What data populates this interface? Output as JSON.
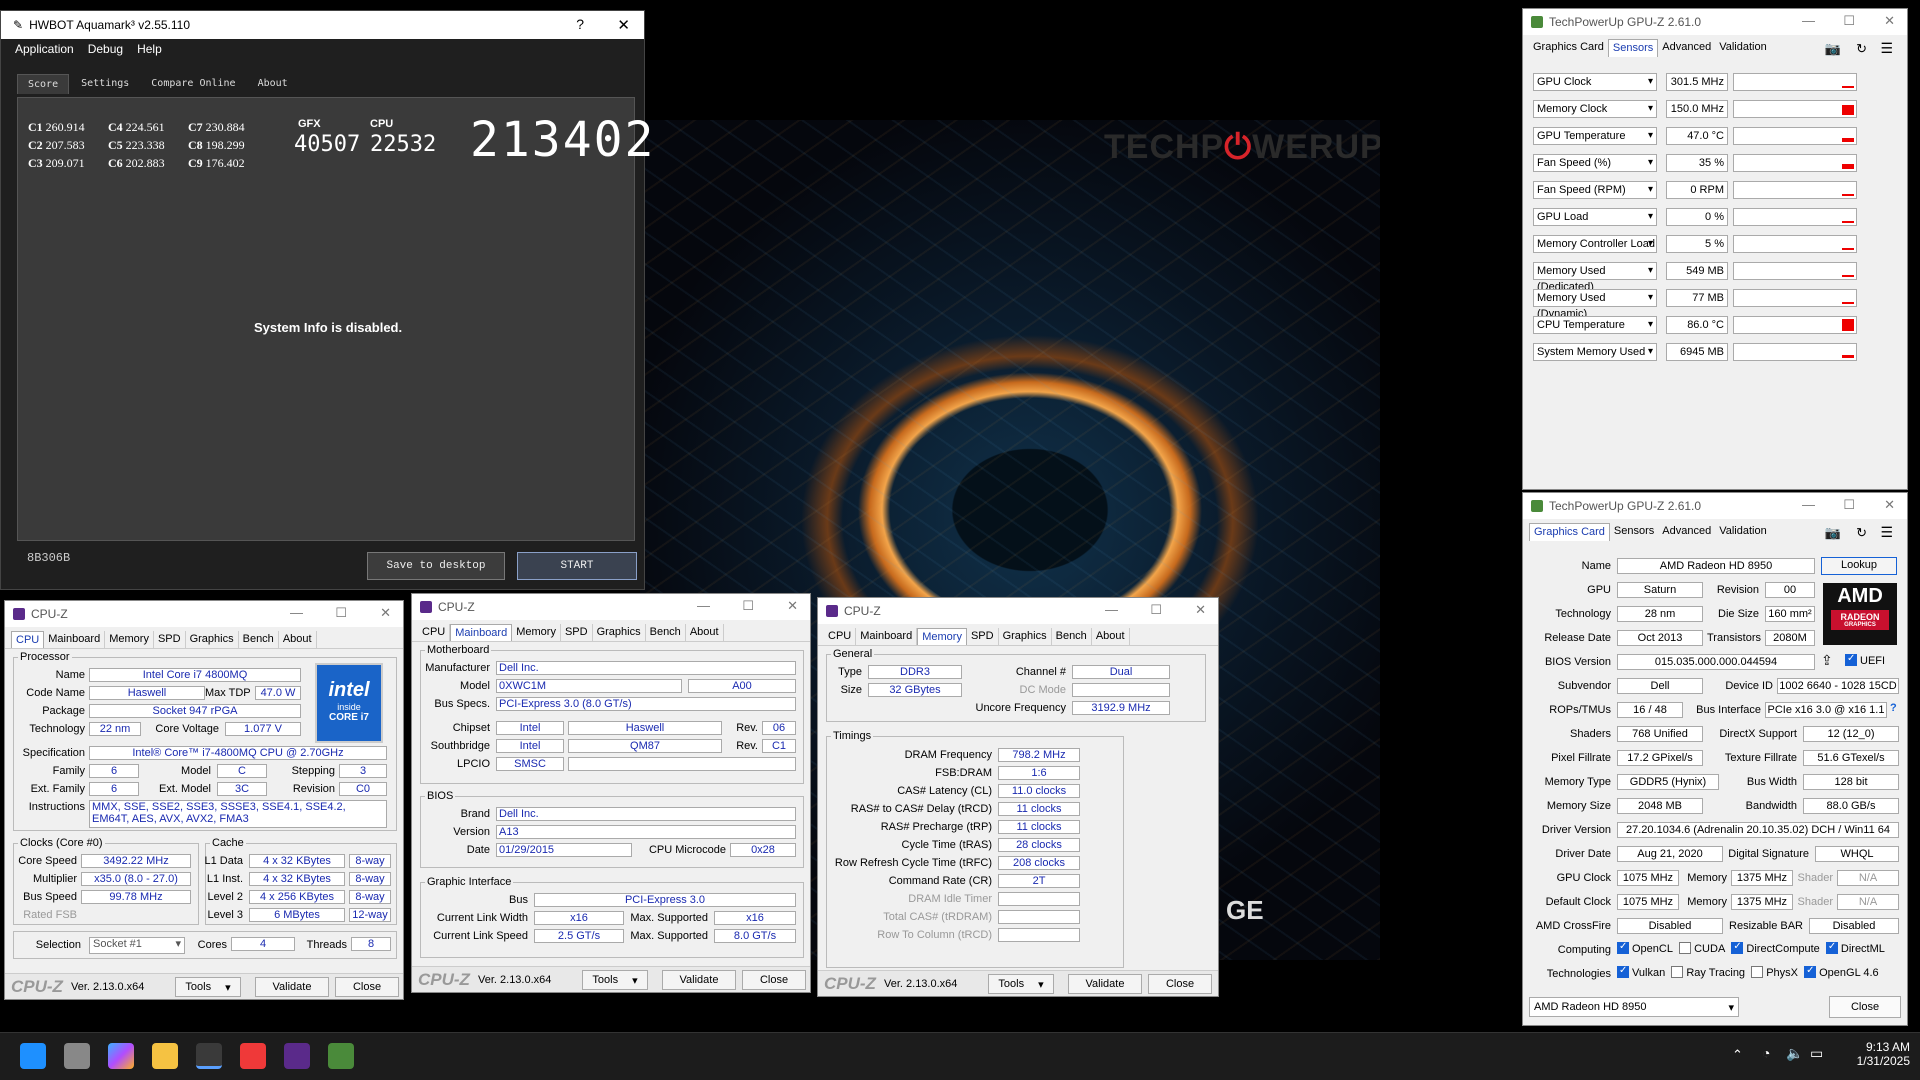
{
  "wallpaper": {
    "logo_tech": "TECHP",
    "logo_rest": "WERUP",
    "tail_text": "GE"
  },
  "aquamark": {
    "title": "HWBOT Aquamark³ v2.55.110",
    "help": "?",
    "close": "✕",
    "menu": [
      "Application",
      "Debug",
      "Help"
    ],
    "tabs": [
      "Score",
      "Settings",
      "Compare Online",
      "About"
    ],
    "scores": [
      [
        "C1",
        "260.914"
      ],
      [
        "C2",
        "207.583"
      ],
      [
        "C3",
        "209.071"
      ],
      [
        "C4",
        "224.561"
      ],
      [
        "C5",
        "223.338"
      ],
      [
        "C6",
        "202.883"
      ],
      [
        "C7",
        "230.884"
      ],
      [
        "C8",
        "198.299"
      ],
      [
        "C9",
        "176.402"
      ]
    ],
    "gfx_label": "GFX",
    "gfx_value": "40507",
    "cpu_label": "CPU",
    "cpu_value": "22532",
    "total": "213402",
    "sysinfo": "System Info is disabled.",
    "code": "8B306B",
    "save": "Save to desktop",
    "start": "START"
  },
  "cpuz1": {
    "title": "CPU-Z",
    "tabs": [
      "CPU",
      "Mainboard",
      "Memory",
      "SPD",
      "Graphics",
      "Bench",
      "About"
    ],
    "proc_legend": "Processor",
    "name_l": "Name",
    "name": "Intel Core i7 4800MQ",
    "code_l": "Code Name",
    "code": "Haswell",
    "tdp_l": "Max TDP",
    "tdp": "47.0 W",
    "pkg_l": "Package",
    "pkg": "Socket 947 rPGA",
    "tech_l": "Technology",
    "tech": "22 nm",
    "cv_l": "Core Voltage",
    "cv": "1.077 V",
    "spec_l": "Specification",
    "spec": "Intel® Core™ i7-4800MQ CPU @ 2.70GHz",
    "fam_l": "Family",
    "fam": "6",
    "model_l": "Model",
    "model": "C",
    "step_l": "Stepping",
    "step": "3",
    "efam_l": "Ext. Family",
    "efam": "6",
    "emodel_l": "Ext. Model",
    "emodel": "3C",
    "rev_l": "Revision",
    "rev": "C0",
    "inst_l": "Instructions",
    "inst": "MMX, SSE, SSE2, SSE3, SSSE3, SSE4.1, SSE4.2, EM64T, AES, AVX, AVX2, FMA3",
    "clk_legend": "Clocks (Core #0)",
    "cs_l": "Core Speed",
    "cs": "3492.22 MHz",
    "mul_l": "Multiplier",
    "mul": "x35.0 (8.0 - 27.0)",
    "bus_l": "Bus Speed",
    "bus": "99.78 MHz",
    "fsb_l": "Rated FSB",
    "cache_legend": "Cache",
    "l1d_l": "L1 Data",
    "l1d": "4 x 32 KBytes",
    "l1d_w": "8-way",
    "l1i_l": "L1 Inst.",
    "l1i": "4 x 32 KBytes",
    "l1i_w": "8-way",
    "l2_l": "Level 2",
    "l2": "4 x 256 KBytes",
    "l2_w": "8-way",
    "l3_l": "Level 3",
    "l3": "6 MBytes",
    "l3_w": "12-way",
    "sel_l": "Selection",
    "sel": "Socket #1",
    "cores_l": "Cores",
    "cores": "4",
    "thr_l": "Threads",
    "thr": "8",
    "intel_brand": "intel",
    "intel_inside": "inside",
    "intel_core": "CORE i7",
    "logo": "CPU-Z",
    "ver": "Ver. 2.13.0.x64",
    "tools": "Tools",
    "validate": "Validate",
    "close": "Close"
  },
  "cpuz2": {
    "title": "CPU-Z",
    "tabs": [
      "CPU",
      "Mainboard",
      "Memory",
      "SPD",
      "Graphics",
      "Bench",
      "About"
    ],
    "mb_legend": "Motherboard",
    "manu_l": "Manufacturer",
    "manu": "Dell Inc.",
    "model_l": "Model",
    "model": "0XWC1M",
    "model_rev": "A00",
    "bus_l": "Bus Specs.",
    "bus": "PCI-Express 3.0 (8.0 GT/s)",
    "chip_l": "Chipset",
    "chip": "Intel",
    "chip2": "Haswell",
    "chip_rl": "Rev.",
    "chip_r": "06",
    "sb_l": "Southbridge",
    "sb": "Intel",
    "sb2": "QM87",
    "sb_rl": "Rev.",
    "sb_r": "C1",
    "lpc_l": "LPCIO",
    "lpc": "SMSC",
    "bios_legend": "BIOS",
    "brand_l": "Brand",
    "brand": "Dell Inc.",
    "ver_l": "Version",
    "ver": "A13",
    "date_l": "Date",
    "date": "01/29/2015",
    "mc_l": "CPU Microcode",
    "mc": "0x28",
    "gi_legend": "Graphic Interface",
    "gbus_l": "Bus",
    "gbus": "PCI-Express 3.0",
    "clw_l": "Current Link Width",
    "clw": "x16",
    "msw_l": "Max. Supported",
    "msw": "x16",
    "cls_l": "Current Link Speed",
    "cls": "2.5 GT/s",
    "mss_l": "Max. Supported",
    "mss": "8.0 GT/s",
    "logo": "CPU-Z",
    "version": "Ver. 2.13.0.x64",
    "tools": "Tools",
    "validate": "Validate",
    "close": "Close"
  },
  "cpuz3": {
    "title": "CPU-Z",
    "tabs": [
      "CPU",
      "Mainboard",
      "Memory",
      "SPD",
      "Graphics",
      "Bench",
      "About"
    ],
    "gen_legend": "General",
    "type_l": "Type",
    "type": "DDR3",
    "ch_l": "Channel #",
    "ch": "Dual",
    "size_l": "Size",
    "size": "32 GBytes",
    "dc_l": "DC Mode",
    "uf_l": "Uncore Frequency",
    "uf": "3192.9 MHz",
    "tim_legend": "Timings",
    "rows": [
      [
        "DRAM Frequency",
        "798.2 MHz"
      ],
      [
        "FSB:DRAM",
        "1:6"
      ],
      [
        "CAS# Latency (CL)",
        "11.0 clocks"
      ],
      [
        "RAS# to CAS# Delay (tRCD)",
        "11 clocks"
      ],
      [
        "RAS# Precharge (tRP)",
        "11 clocks"
      ],
      [
        "Cycle Time (tRAS)",
        "28 clocks"
      ],
      [
        "Row Refresh Cycle Time (tRFC)",
        "208 clocks"
      ],
      [
        "Command Rate (CR)",
        "2T"
      ],
      [
        "DRAM Idle Timer",
        ""
      ],
      [
        "Total CAS# (tRDRAM)",
        ""
      ],
      [
        "Row To Column (tRCD)",
        ""
      ]
    ],
    "logo": "CPU-Z",
    "version": "Ver. 2.13.0.x64",
    "tools": "Tools",
    "validate": "Validate",
    "close": "Close"
  },
  "gpuz1": {
    "title": "TechPowerUp GPU-Z 2.61.0",
    "tabs": [
      "Graphics Card",
      "Sensors",
      "Advanced",
      "Validation"
    ],
    "sensors": [
      [
        "GPU Clock",
        "301.5 MHz",
        0.1
      ],
      [
        "Memory Clock",
        "150.0 MHz",
        0.7
      ],
      [
        "GPU Temperature",
        "47.0 °C",
        0.3
      ],
      [
        "Fan Speed (%)",
        "35 %",
        0.35
      ],
      [
        "Fan Speed (RPM)",
        "0 RPM",
        0
      ],
      [
        "GPU Load",
        "0 %",
        0
      ],
      [
        "Memory Controller Load",
        "5 %",
        0.05
      ],
      [
        "Memory Used (Dedicated)",
        "549 MB",
        0.15
      ],
      [
        "Memory Used (Dynamic)",
        "77 MB",
        0.05
      ],
      [
        "CPU Temperature",
        "86.0 °C",
        0.86
      ],
      [
        "System Memory Used",
        "6945 MB",
        0.2
      ]
    ]
  },
  "gpuz2": {
    "title": "TechPowerUp GPU-Z 2.61.0",
    "tabs": [
      "Graphics Card",
      "Sensors",
      "Advanced",
      "Validation"
    ],
    "name_l": "Name",
    "name": "AMD Radeon HD 8950",
    "lookup": "Lookup",
    "gpu_l": "GPU",
    "gpu": "Saturn",
    "rev_l": "Revision",
    "rev": "00",
    "tech_l": "Technology",
    "tech": "28 nm",
    "die_l": "Die Size",
    "die": "160 mm²",
    "rd_l": "Release Date",
    "rd": "Oct 2013",
    "tr_l": "Transistors",
    "tr": "2080M",
    "bios_l": "BIOS Version",
    "bios": "015.035.000.000.044594",
    "uefi": "UEFI",
    "sub_l": "Subvendor",
    "sub": "Dell",
    "did_l": "Device ID",
    "did": "1002 6640 - 1028 15CD",
    "rop_l": "ROPs/TMUs",
    "rop": "16 / 48",
    "bi_l": "Bus Interface",
    "bi": "PCIe x16 3.0 @ x16 1.1",
    "sh_l": "Shaders",
    "sh": "768 Unified",
    "dx_l": "DirectX Support",
    "dx": "12 (12_0)",
    "pf_l": "Pixel Fillrate",
    "pf": "17.2 GPixel/s",
    "tf_l": "Texture Fillrate",
    "tf": "51.6 GTexel/s",
    "mt_l": "Memory Type",
    "mt": "GDDR5 (Hynix)",
    "bw_l": "Bus Width",
    "bw": "128 bit",
    "ms_l": "Memory Size",
    "ms": "2048 MB",
    "band_l": "Bandwidth",
    "band": "88.0 GB/s",
    "dv_l": "Driver Version",
    "dv": "27.20.1034.6 (Adrenalin 20.10.35.02) DCH / Win11 64",
    "dd_l": "Driver Date",
    "dd": "Aug 21, 2020",
    "ds_l": "Digital Signature",
    "ds": "WHQL",
    "gc_l": "GPU Clock",
    "gc": "1075 MHz",
    "mem_l": "Memory",
    "gcm": "1375 MHz",
    "shd_l": "Shader",
    "na": "N/A",
    "dc_l": "Default Clock",
    "dc": "1075 MHz",
    "dcm": "1375 MHz",
    "cf_l": "AMD CrossFire",
    "cf": "Disabled",
    "rb_l": "Resizable BAR",
    "rb": "Disabled",
    "comp_l": "Computing",
    "comp": [
      "OpenCL",
      "CUDA",
      "DirectCompute",
      "DirectML"
    ],
    "techs_l": "Technologies",
    "techs": [
      "Vulkan",
      "Ray Tracing",
      "PhysX",
      "OpenGL 4.6"
    ],
    "card_sel": "AMD Radeon HD 8950",
    "close": "Close",
    "amd_logo": "AMD",
    "radeon_logo": "RADEON",
    "graphics_logo": "GRAPHICS"
  },
  "taskbar": {
    "time": "9:13 AM",
    "date": "1/31/2025"
  }
}
